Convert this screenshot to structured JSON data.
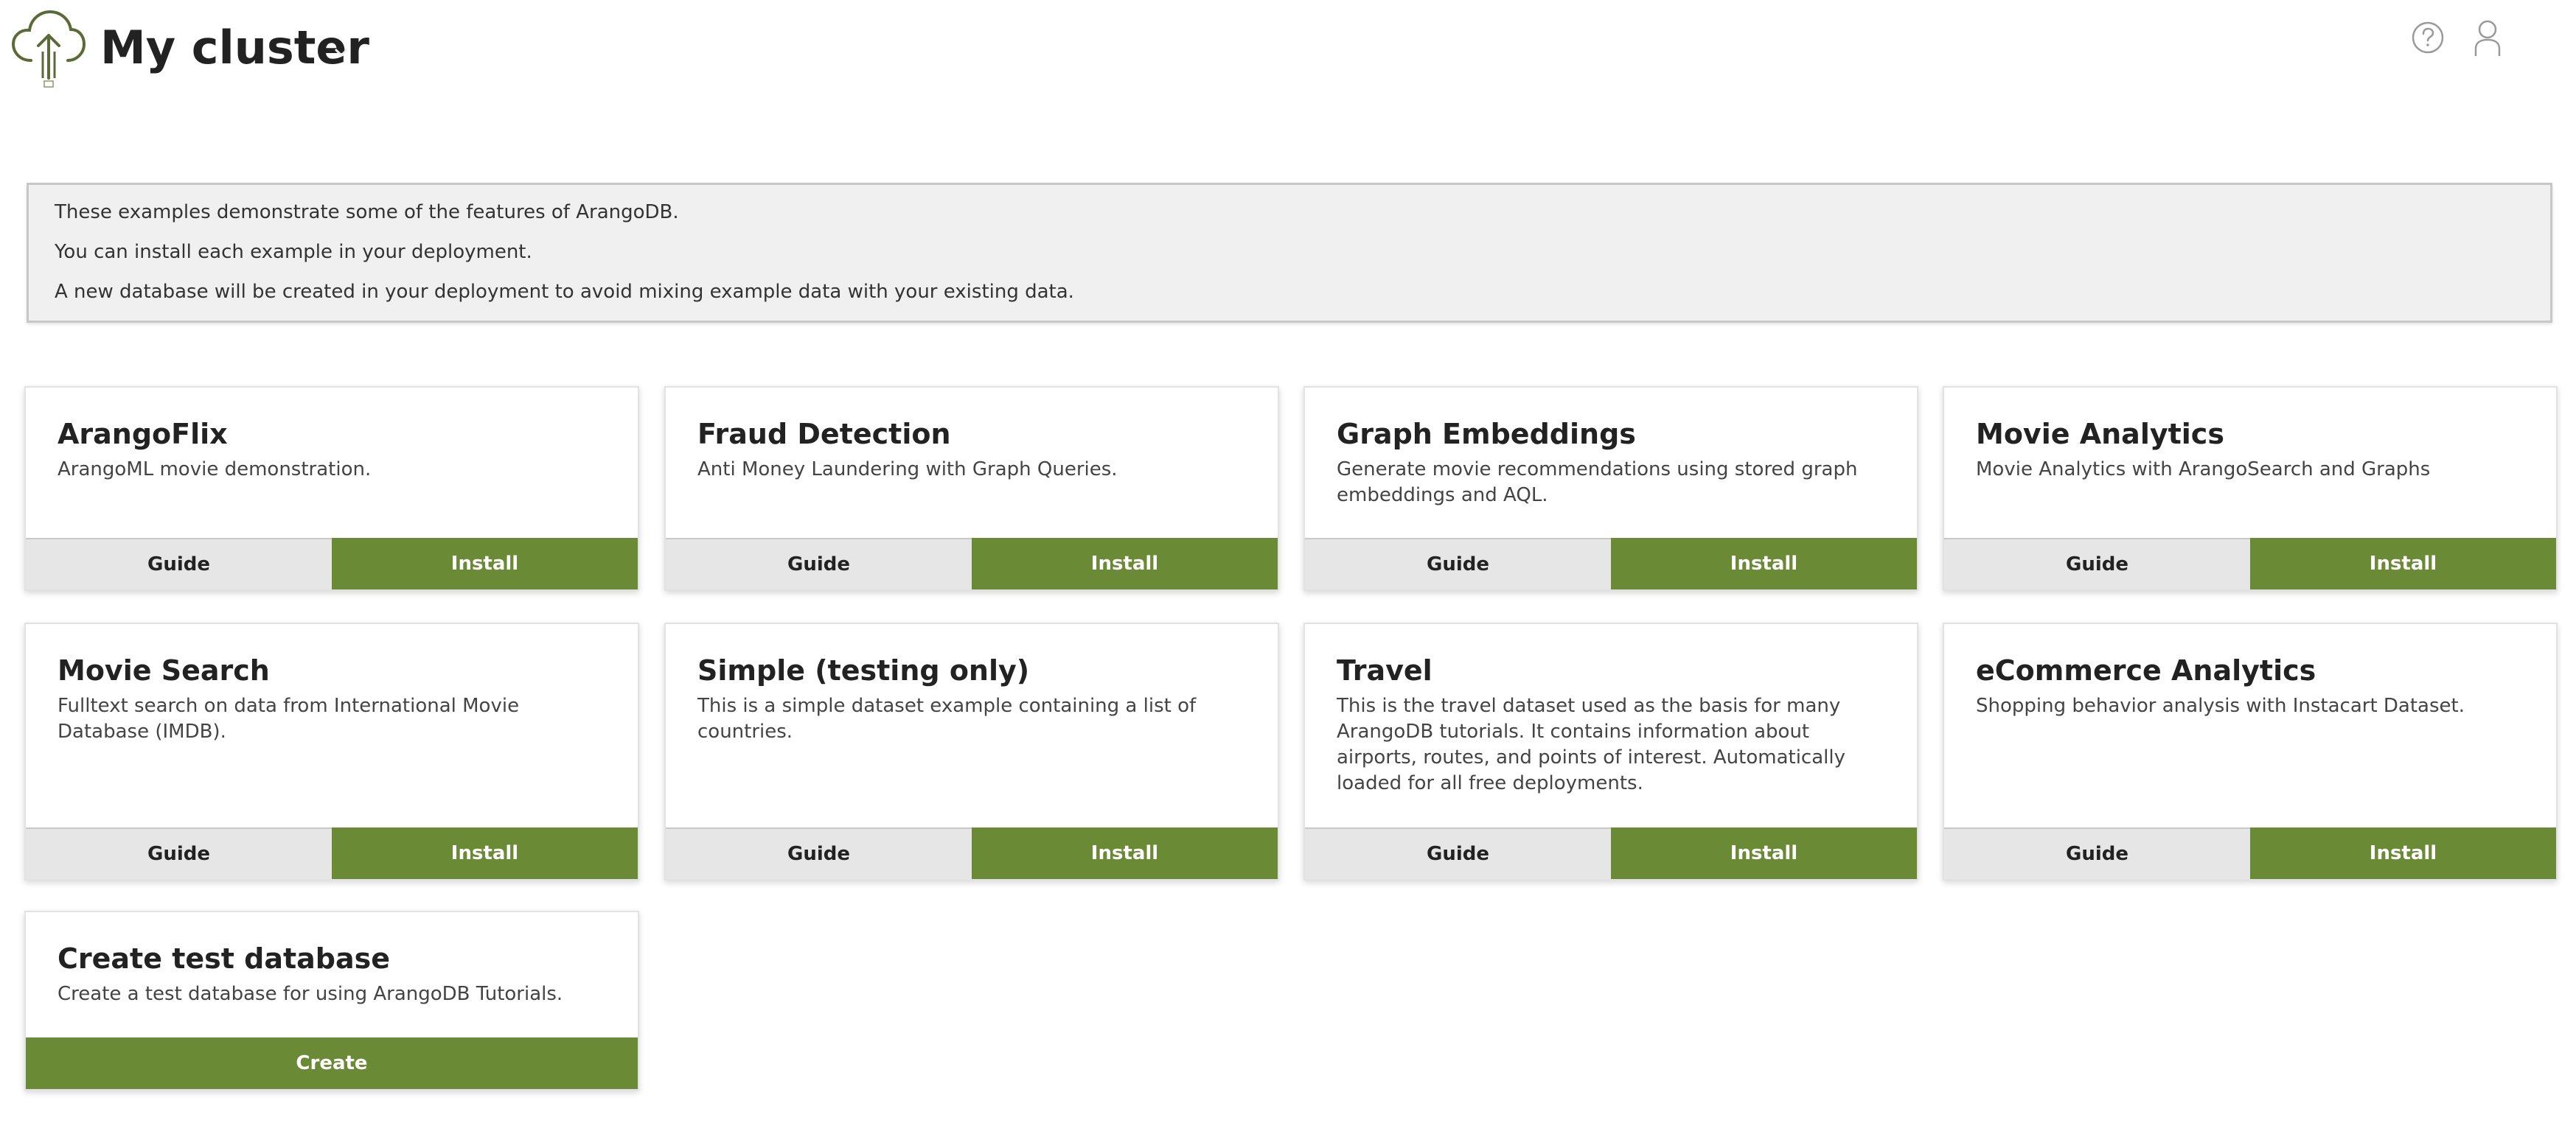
{
  "header": {
    "cluster_title": "My cluster"
  },
  "info": {
    "lines": [
      "These examples demonstrate some of the features of ArangoDB.",
      "You can install each example in your deployment.",
      "A new database will be created in your deployment to avoid mixing example data with your existing data."
    ]
  },
  "cards": [
    {
      "title": "ArangoFlix",
      "description": "ArangoML movie demonstration.",
      "guide_label": "Guide",
      "install_label": "Install"
    },
    {
      "title": "Fraud Detection",
      "description": "Anti Money Laundering with Graph Queries.",
      "guide_label": "Guide",
      "install_label": "Install"
    },
    {
      "title": "Graph Embeddings",
      "description": "Generate movie recommendations using stored graph embeddings and AQL.",
      "guide_label": "Guide",
      "install_label": "Install"
    },
    {
      "title": "Movie Analytics",
      "description": "Movie Analytics with ArangoSearch and Graphs",
      "guide_label": "Guide",
      "install_label": "Install"
    },
    {
      "title": "Movie Search",
      "description": "Fulltext search on data from International Movie Database (IMDB).",
      "guide_label": "Guide",
      "install_label": "Install"
    },
    {
      "title": "Simple (testing only)",
      "description": "This is a simple dataset example containing a list of countries.",
      "guide_label": "Guide",
      "install_label": "Install"
    },
    {
      "title": "Travel",
      "description": "This is the travel dataset used as the basis for many ArangoDB tutorials. It contains information about airports, routes, and points of interest. Automatically loaded for all free deployments.",
      "guide_label": "Guide",
      "install_label": "Install"
    },
    {
      "title": "eCommerce Analytics",
      "description": "Shopping behavior analysis with Instacart Dataset.",
      "guide_label": "Guide",
      "install_label": "Install"
    }
  ],
  "create_card": {
    "title": "Create test database",
    "description": "Create a test database for using ArangoDB Tutorials.",
    "create_label": "Create"
  },
  "colors": {
    "accent": "#6b8a36",
    "guide_bg": "#e6e6e6",
    "info_bg": "#f0f0f0"
  },
  "icons": {
    "logo": "cloud-upload-logo",
    "cluster_selector": "chevron-down-icon",
    "help": "help-circle-icon",
    "user": "user-icon"
  }
}
